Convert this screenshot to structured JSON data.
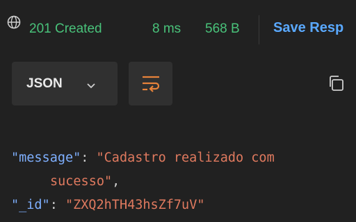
{
  "response": {
    "status": "201 Created",
    "time": "8 ms",
    "size": "568 B",
    "save_label": "Save Resp",
    "format": "JSON",
    "body": {
      "line1_key": "\"message\"",
      "line1_colon": ": ",
      "line1_value": "\"Cadastro realizado com",
      "line2_value": "sucesso\"",
      "line2_comma": ",",
      "line3_key": "\"_id\"",
      "line3_colon": ": ",
      "line3_value": "\"ZXQ2hTH43hsZf7uV\""
    }
  },
  "colors": {
    "background": "#212121",
    "status_green": "#49c27a",
    "link_blue": "#5aa9ff",
    "json_key": "#7fb0ff",
    "json_string": "#e07a5f"
  },
  "icons": {
    "network": "globe-icon",
    "format_dropdown": "chevron-down-icon",
    "wrap": "wrap-lines-icon",
    "copy": "copy-icon"
  }
}
